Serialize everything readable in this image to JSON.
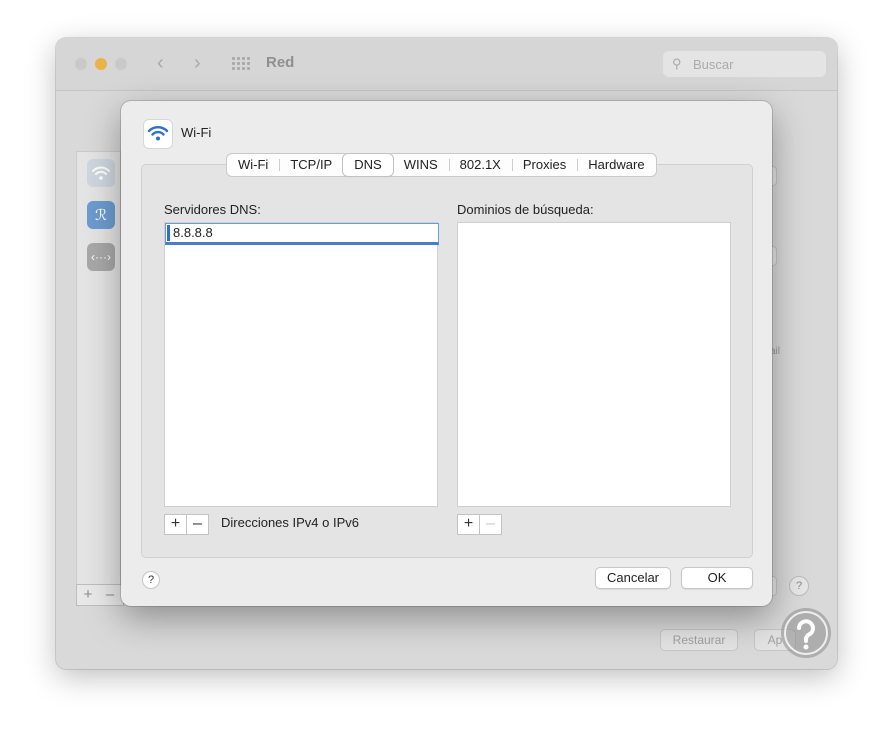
{
  "background_window": {
    "title": "Red",
    "search_placeholder": "Buscar",
    "restore_label": "Restaurar",
    "apply_label": "Ap",
    "sidebar_add": "+",
    "sidebar_remove": "–",
    "partial_text": "ail",
    "help": "?"
  },
  "sheet": {
    "title": "Wi-Fi",
    "tabs": [
      "Wi-Fi",
      "TCP/IP",
      "DNS",
      "WINS",
      "802.1X",
      "Proxies",
      "Hardware"
    ],
    "active_tab": "DNS",
    "dns_servers": {
      "label": "Servidores DNS:",
      "entries": [
        "8.8.8.8"
      ],
      "add": "+",
      "remove": "–",
      "hint": "Direcciones IPv4 o IPv6"
    },
    "search_domains": {
      "label": "Dominios de búsqueda:",
      "add": "+",
      "remove": "–"
    },
    "help": "?",
    "cancel_label": "Cancelar",
    "ok_label": "OK"
  },
  "colors": {
    "accent": "#2f6fd0",
    "minimize_dot": "#e8b24d",
    "bluetooth": "#4a90e2"
  }
}
